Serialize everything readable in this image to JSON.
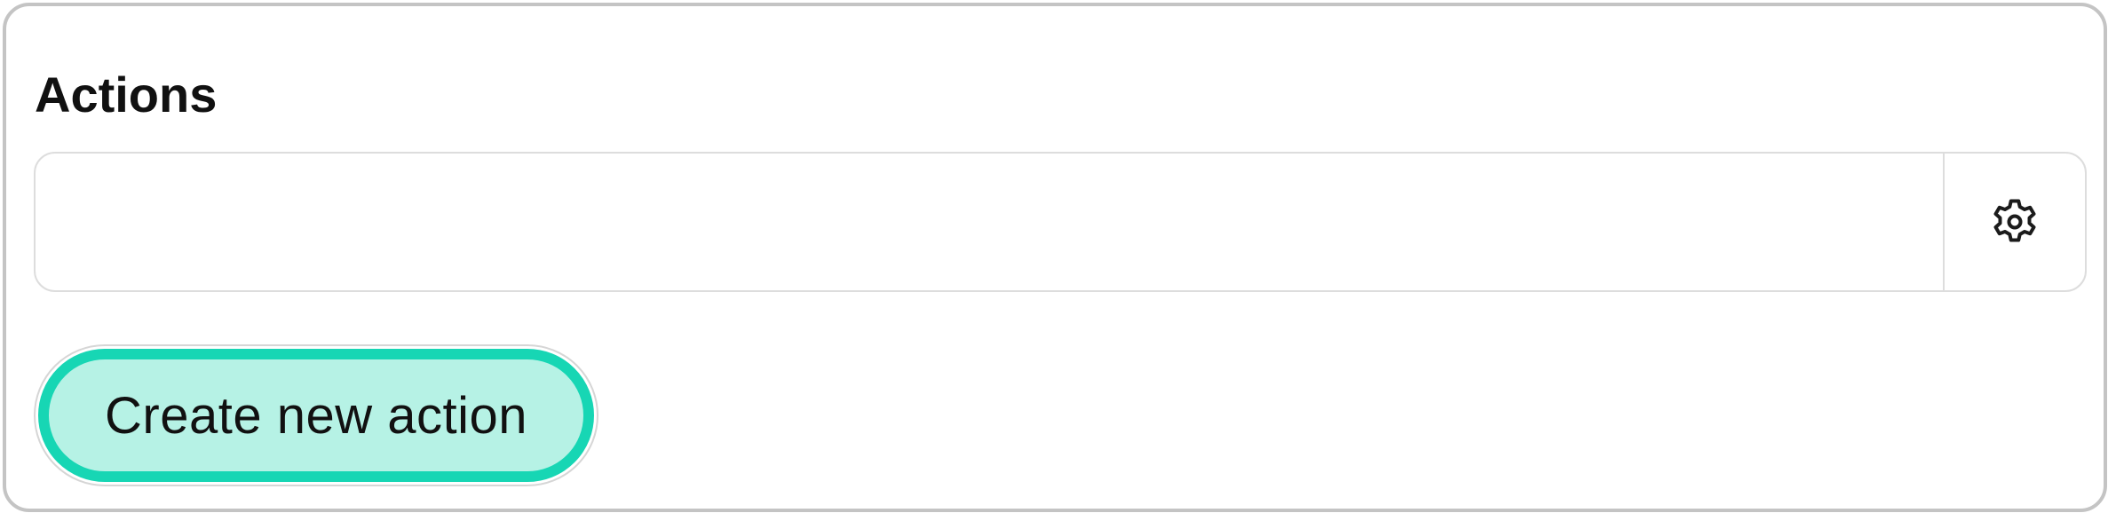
{
  "panel": {
    "title": "Actions"
  },
  "action_field": {
    "value": "",
    "placeholder": "",
    "settings_icon": "gear-icon"
  },
  "create_button": {
    "label": "Create new action"
  },
  "colors": {
    "accent_border": "#17d6b4",
    "accent_fill": "#b6f2e5",
    "panel_border": "#c4c4c4"
  }
}
